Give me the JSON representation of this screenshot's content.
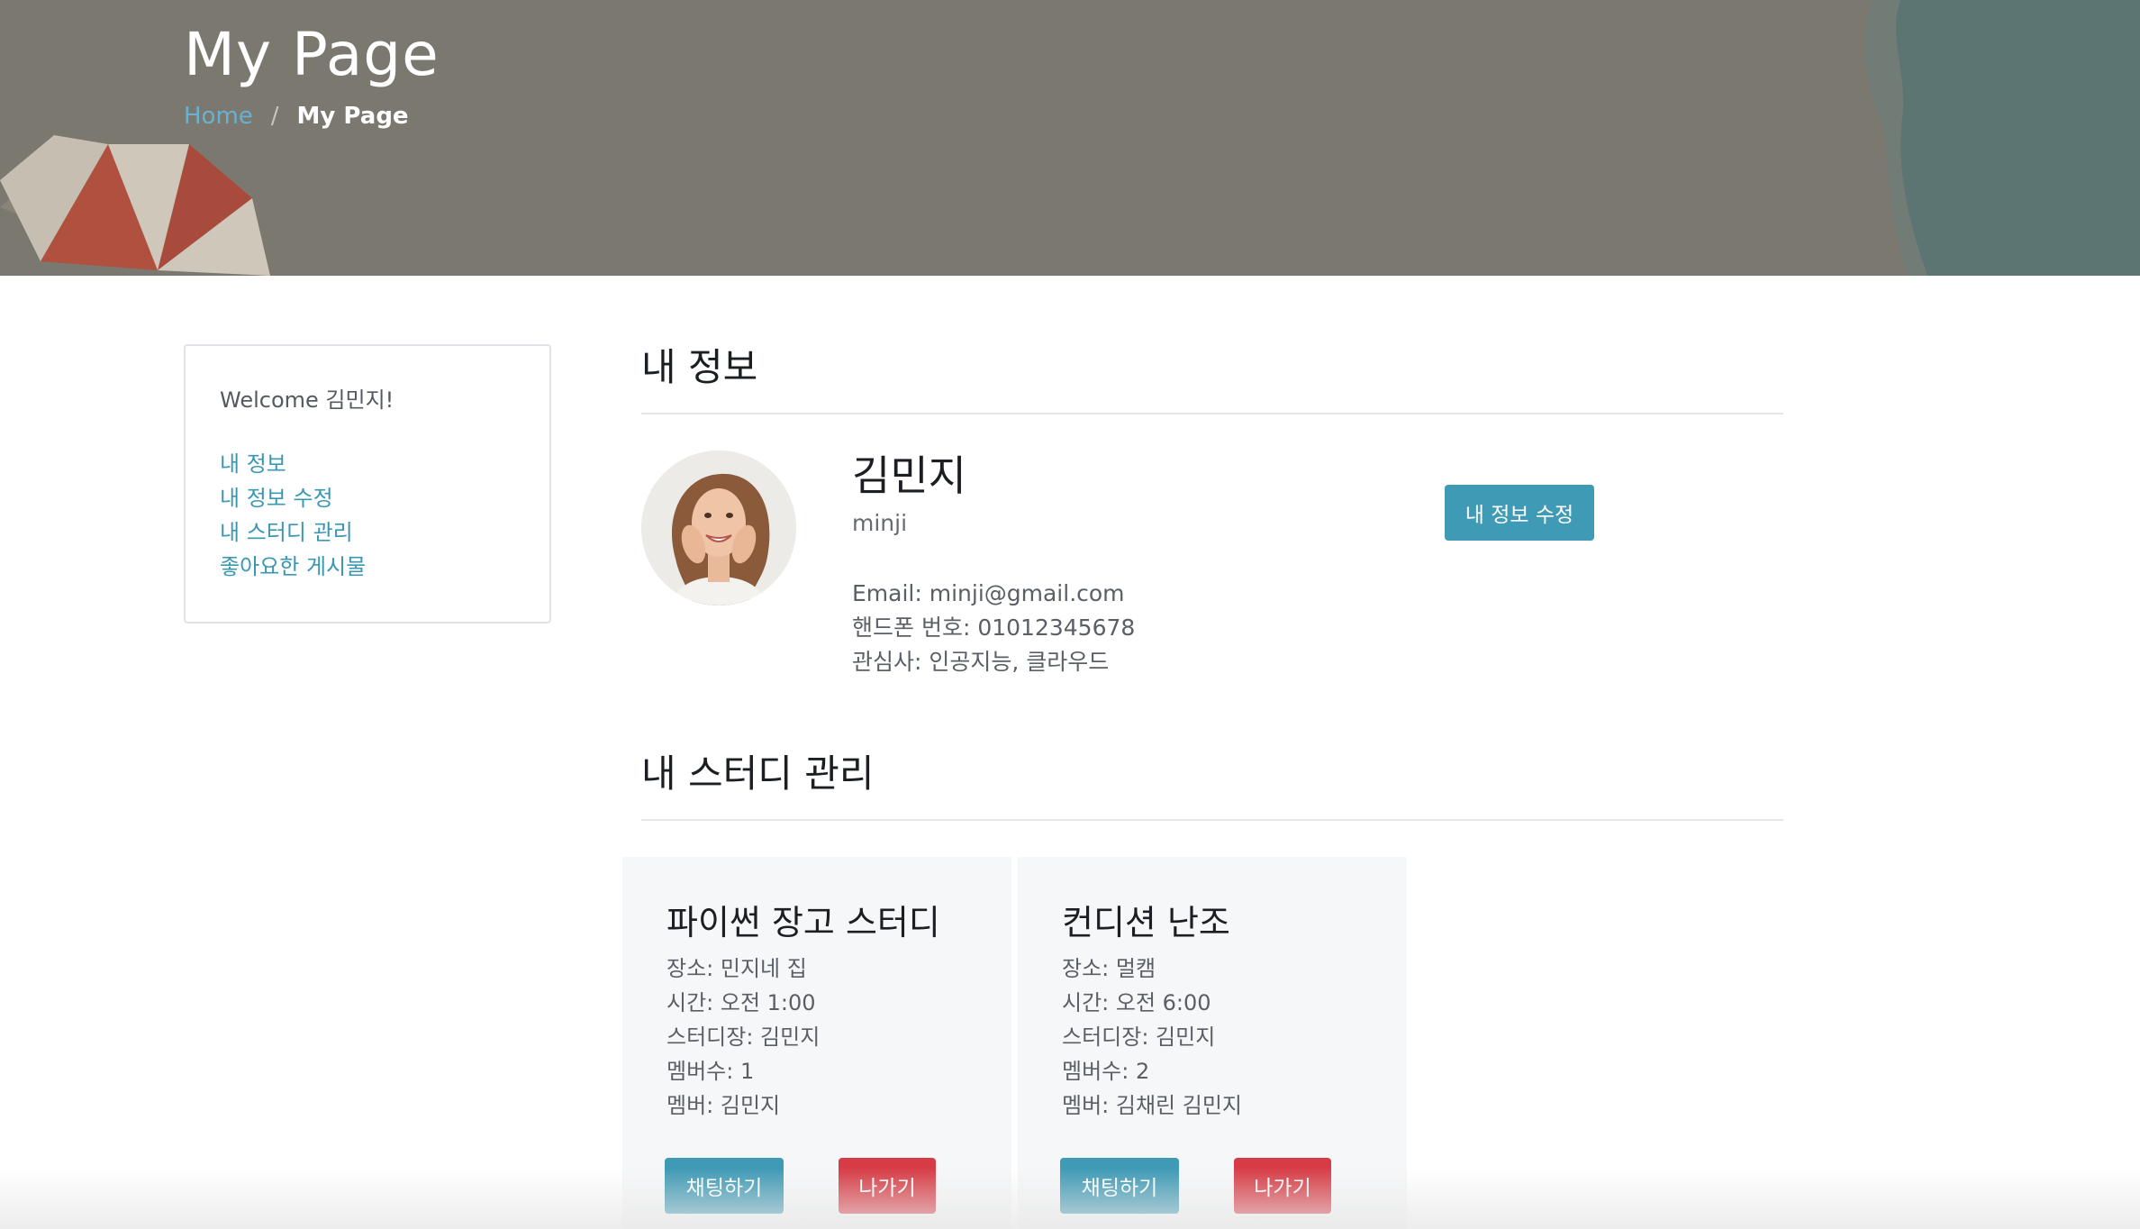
{
  "header": {
    "title": "My Page",
    "breadcrumb": {
      "home": "Home",
      "separator": "/",
      "current": "My Page"
    }
  },
  "sidebar": {
    "welcome": "Welcome 김민지!",
    "links": [
      "내 정보",
      "내 정보 수정",
      "내 스터디 관리",
      "좋아요한 게시물"
    ]
  },
  "profile": {
    "section_title": "내 정보",
    "name": "김민지",
    "username": "minji",
    "email_line": "Email: minji@gmail.com",
    "phone_line": "핸드폰 번호: 01012345678",
    "interests_line": "관심사: 인공지능, 클라우드",
    "edit_button": "내 정보 수정"
  },
  "studies": {
    "section_title": "내 스터디 관리",
    "cards": [
      {
        "title": "파이썬 장고 스터디",
        "place": "장소: 민지네 집",
        "time": "시간: 오전 1:00",
        "leader": "스터디장: 김민지",
        "member_count": "멤버수: 1",
        "members": "멤버: 김민지",
        "chat_button": "채팅하기",
        "leave_button": "나가기"
      },
      {
        "title": "컨디션 난조",
        "place": "장소: 멀캠",
        "time": "시간: 오전 6:00",
        "leader": "스터디장: 김민지",
        "member_count": "멤버수: 2",
        "members": "멤버: 김채린 김민지",
        "chat_button": "채팅하기",
        "leave_button": "나가기"
      }
    ]
  },
  "colors": {
    "hero_overlay": "#7b7870",
    "link": "#3a97b4",
    "info_button": "#3f9ab5",
    "danger_button": "#d73c46",
    "card_background": "#f6f7f8"
  }
}
